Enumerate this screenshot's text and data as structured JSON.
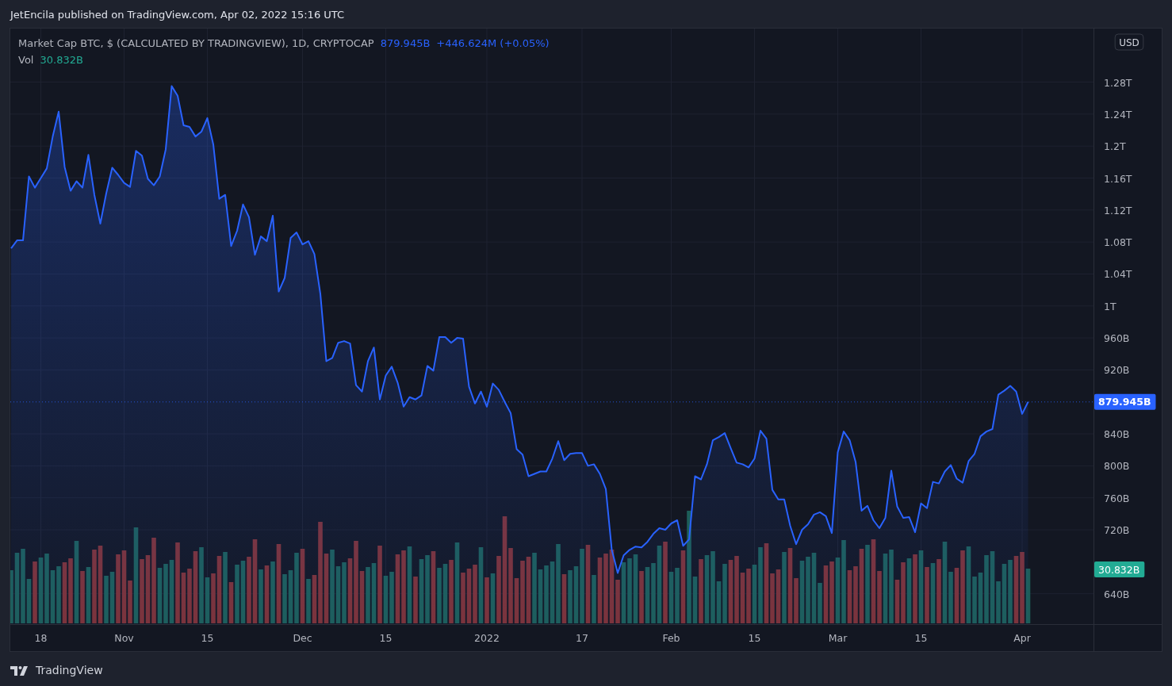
{
  "header": {
    "publisher_line": "JetEncila published on TradingView.com, Apr 02, 2022 15:16 UTC"
  },
  "legend": {
    "price": "879.945B",
    "change": "+446.624M (+0.05%)",
    "volume_label": "Vol",
    "volume_value": "30.832B"
  },
  "price_scale": {
    "currency": "USD",
    "last_price": "879.945B",
    "last_volume": "30.832B"
  },
  "chart": {
    "chart_data": {
      "type": "area",
      "grid": true,
      "categories": [
        null,
        null,
        null,
        null,
        null,
        "18",
        null,
        null,
        null,
        null,
        null,
        null,
        null,
        null,
        null,
        null,
        null,
        null,
        null,
        "Nov",
        null,
        null,
        null,
        null,
        null,
        null,
        null,
        null,
        null,
        null,
        null,
        null,
        null,
        "15",
        null,
        null,
        null,
        null,
        null,
        null,
        null,
        null,
        null,
        null,
        null,
        null,
        null,
        null,
        null,
        "Dec",
        null,
        null,
        null,
        null,
        null,
        null,
        null,
        null,
        null,
        null,
        null,
        null,
        null,
        "15",
        null,
        null,
        null,
        null,
        null,
        null,
        null,
        null,
        null,
        null,
        null,
        null,
        null,
        null,
        null,
        null,
        "2022",
        null,
        null,
        null,
        null,
        null,
        null,
        null,
        null,
        null,
        null,
        null,
        null,
        null,
        null,
        null,
        "17",
        null,
        null,
        null,
        null,
        null,
        null,
        null,
        null,
        null,
        null,
        null,
        null,
        null,
        null,
        "Feb",
        null,
        null,
        null,
        null,
        null,
        null,
        null,
        null,
        null,
        null,
        null,
        null,
        null,
        "15",
        null,
        null,
        null,
        null,
        null,
        null,
        null,
        null,
        null,
        null,
        null,
        null,
        null,
        "Mar",
        null,
        null,
        null,
        null,
        null,
        null,
        null,
        null,
        null,
        null,
        null,
        null,
        null,
        "15",
        null,
        null,
        null,
        null,
        null,
        null,
        null,
        null,
        null,
        null,
        null,
        null,
        null,
        null,
        null,
        null,
        "Apr",
        null
      ],
      "ylim": [
        602000000000,
        1347000000000
      ],
      "yticks": [
        {
          "value": 640000000000,
          "label": "640B"
        },
        {
          "value": 720000000000,
          "label": "720B"
        },
        {
          "value": 760000000000,
          "label": "760B"
        },
        {
          "value": 800000000000,
          "label": "800B"
        },
        {
          "value": 840000000000,
          "label": "840B"
        },
        {
          "value": 920000000000,
          "label": "920B"
        },
        {
          "value": 960000000000,
          "label": "960B"
        },
        {
          "value": 1000000000000,
          "label": "1T"
        },
        {
          "value": 1040000000000,
          "label": "1.04T"
        },
        {
          "value": 1080000000000,
          "label": "1.08T"
        },
        {
          "value": 1120000000000,
          "label": "1.12T"
        },
        {
          "value": 1160000000000,
          "label": "1.16T"
        },
        {
          "value": 1200000000000,
          "label": "1.2T"
        },
        {
          "value": 1240000000000,
          "label": "1.24T"
        },
        {
          "value": 1280000000000,
          "label": "1.28T"
        }
      ],
      "ref_lines": [
        {
          "axis": "y",
          "value": 879945000000,
          "color": "#2962ff"
        }
      ],
      "series": [
        {
          "name": "Market Cap BTC, $ (CALCULATED BY TRADINGVIEW), 1D, CRYPTOCAP",
          "color": "#2962ff",
          "values": [
            1072000000000.0,
            1082000000000.0,
            1082000000000.0,
            1162000000000.0,
            1148000000000.0,
            1160000000000.0,
            1172000000000.0,
            1212000000000.0,
            1243000000000.0,
            1174000000000.0,
            1144000000000.0,
            1156000000000.0,
            1148000000000.0,
            1189000000000.0,
            1139000000000.0,
            1103000000000.0,
            1141000000000.0,
            1173000000000.0,
            1164000000000.0,
            1154000000000.0,
            1149000000000.0,
            1194000000000.0,
            1188000000000.0,
            1159000000000.0,
            1151000000000.0,
            1162000000000.0,
            1196000000000.0,
            1275000000000.0,
            1263000000000.0,
            1226000000000.0,
            1224000000000.0,
            1212000000000.0,
            1218000000000.0,
            1235000000000.0,
            1202000000000.0,
            1134000000000.0,
            1139000000000.0,
            1075000000000.0,
            1094000000000.0,
            1127000000000.0,
            1111000000000.0,
            1064000000000.0,
            1087000000000.0,
            1081000000000.0,
            1113000000000.0,
            1018000000000.0,
            1035000000000.0,
            1085000000000.0,
            1092000000000.0,
            1077000000000.0,
            1081000000000.0,
            1065000000000.0,
            1015000000000.0,
            931000000000.0,
            935000000000.0,
            954000000000.0,
            956000000000.0,
            953000000000.0,
            901000000000.0,
            893000000000.0,
            931000000000.0,
            948000000000.0,
            883000000000.0,
            913000000000.0,
            924000000000.0,
            904000000000.0,
            874000000000.0,
            886000000000.0,
            883000000000.0,
            888000000000.0,
            925000000000.0,
            919000000000.0,
            961000000000.0,
            961000000000.0,
            954000000000.0,
            960000000000.0,
            959000000000.0,
            899000000000.0,
            878000000000.0,
            893000000000.0,
            874000000000.0,
            903000000000.0,
            895000000000.0,
            880000000000.0,
            866000000000.0,
            821000000000.0,
            814000000000.0,
            787000000000.0,
            790000000000.0,
            793000000000.0,
            793000000000.0,
            809000000000.0,
            831000000000.0,
            807000000000.0,
            815000000000.0,
            816000000000.0,
            816000000000.0,
            800000000000.0,
            802000000000.0,
            790000000000.0,
            771000000000.0,
            695000000000.0,
            666000000000.0,
            688000000000.0,
            695000000000.0,
            699000000000.0,
            698000000000.0,
            705000000000.0,
            715000000000.0,
            722000000000.0,
            720000000000.0,
            728000000000.0,
            732000000000.0,
            700000000000.0,
            708000000000.0,
            787000000000.0,
            783000000000.0,
            802000000000.0,
            832000000000.0,
            836000000000.0,
            841000000000.0,
            822000000000.0,
            804000000000.0,
            802000000000.0,
            798000000000.0,
            809000000000.0,
            844000000000.0,
            834000000000.0,
            770000000000.0,
            758000000000.0,
            758000000000.0,
            725000000000.0,
            702000000000.0,
            720000000000.0,
            727000000000.0,
            739000000000.0,
            742000000000.0,
            737000000000.0,
            716000000000.0,
            817000000000.0,
            843000000000.0,
            832000000000.0,
            805000000000.0,
            744000000000.0,
            750000000000.0,
            732000000000.0,
            722000000000.0,
            735000000000.0,
            794000000000.0,
            749000000000.0,
            735000000000.0,
            736000000000.0,
            717000000000.0,
            753000000000.0,
            747000000000.0,
            780000000000.0,
            778000000000.0,
            793000000000.0,
            801000000000.0,
            784000000000.0,
            779000000000.0,
            806000000000.0,
            815000000000.0,
            837000000000.0,
            843000000000.0,
            846000000000.0,
            889000000000.0,
            894000000000.0,
            900000000000.0,
            893000000000.0,
            865000000000.0,
            880000000000.0
          ]
        }
      ]
    }
  },
  "footer": {
    "brand": "TradingView"
  }
}
